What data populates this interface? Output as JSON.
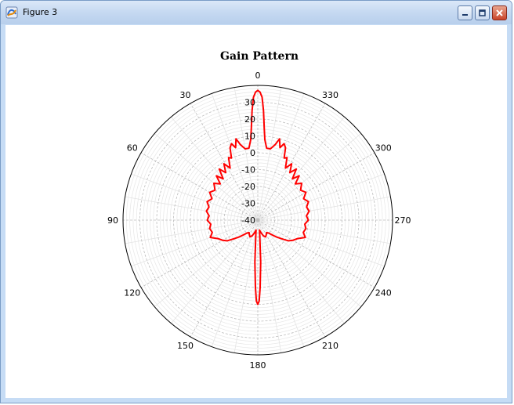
{
  "window": {
    "title": "Figure 3"
  },
  "chart_data": {
    "type": "polar",
    "title": "Gain Pattern",
    "theta_direction": "counterclockwise",
    "theta_zero": "top",
    "theta_ticks": [
      0,
      30,
      60,
      90,
      120,
      150,
      180,
      210,
      240,
      270,
      300,
      330
    ],
    "theta_tick_labels": [
      "0",
      "30",
      "60",
      "90",
      "120",
      "150",
      "180",
      "210",
      "240",
      "270",
      "300",
      "330"
    ],
    "r_range": [
      -40,
      40
    ],
    "r_ticks": [
      -40,
      -30,
      -20,
      -10,
      0,
      10,
      20,
      30
    ],
    "r_tick_labels": [
      "-40",
      "-30",
      "-20",
      "-10",
      "0",
      "10",
      "20",
      "30"
    ],
    "grid": true,
    "series": [
      {
        "color": "#ff0000",
        "theta": [
          0,
          1,
          2,
          3,
          4,
          5,
          7,
          10,
          13,
          15,
          17,
          19,
          21,
          23,
          25,
          28,
          31,
          34,
          37,
          40,
          43,
          46,
          50,
          55,
          60,
          65,
          70,
          75,
          80,
          85,
          90,
          95,
          100,
          105,
          110,
          115,
          120,
          124,
          128,
          132,
          136,
          140,
          145,
          150,
          155,
          160,
          165,
          170,
          173,
          176,
          178,
          179,
          180
        ],
        "r": [
          37,
          36,
          33,
          25,
          15,
          8,
          3,
          3,
          6,
          10,
          5,
          8,
          6,
          0,
          1,
          -5,
          -1,
          -6,
          -2,
          -8,
          -4,
          -9,
          -6,
          -9,
          -7,
          -10,
          -8,
          -10,
          -9,
          -11,
          -10,
          -12,
          -11,
          -12,
          -10,
          -14,
          -16,
          -18,
          -22,
          -25,
          -28,
          -30,
          -31,
          -30,
          -29,
          -30,
          -32,
          -34,
          -30,
          -15,
          0,
          8,
          10
        ]
      }
    ]
  }
}
